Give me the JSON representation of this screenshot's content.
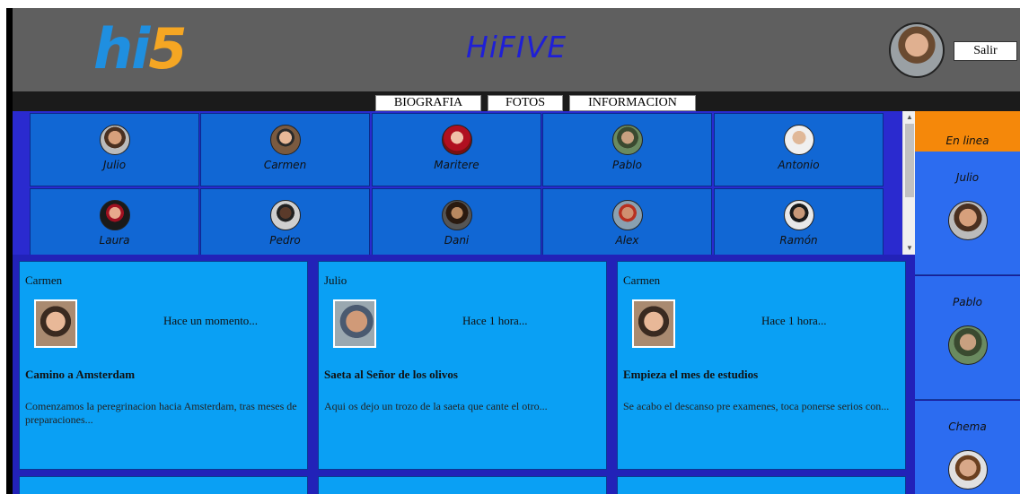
{
  "header": {
    "logo_h": "hi",
    "logo_5": "5",
    "title": "HiFIVE",
    "logout_label": "Salir"
  },
  "nav": {
    "tabs": [
      "BIOGRAFIA",
      "FOTOS",
      "INFORMACION"
    ]
  },
  "friends": [
    "Julio",
    "Carmen",
    "Maritere",
    "Pablo",
    "Antonio",
    "Laura",
    "Pedro",
    "Dani",
    "Alex",
    "Ramón"
  ],
  "posts": [
    {
      "author": "Carmen",
      "time": "Hace un momento...",
      "title": "Camino a Amsterdam",
      "body": "Comenzamos la peregrinacion hacia Amsterdam, tras meses de preparaciones..."
    },
    {
      "author": "Julio",
      "time": "Hace 1 hora...",
      "title": "Saeta al Señor de los olivos",
      "body": "Aqui os dejo un trozo de la saeta que cante el otro..."
    },
    {
      "author": "Carmen",
      "time": "Hace 1 hora...",
      "title": "Empieza el mes de estudios",
      "body": "Se acabo el descanso pre examenes, toca ponerse serios con..."
    }
  ],
  "online": {
    "header": "En linea",
    "users": [
      "Julio",
      "Pablo",
      "Chema"
    ]
  },
  "colors": {
    "header_bg": "#5f5f5f",
    "title": "#1f1fd6",
    "friends_bg": "#1167d4",
    "post_bg": "#0aa0f4",
    "online_header": "#f5880a",
    "online_bg": "#2c6cf0"
  }
}
